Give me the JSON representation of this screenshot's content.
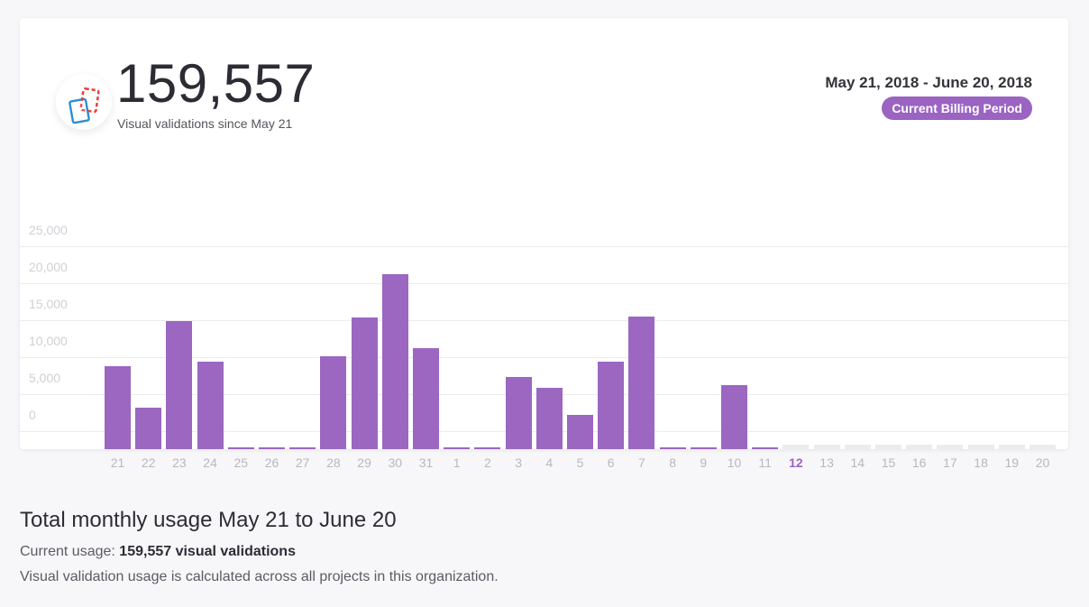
{
  "header": {
    "total_count": "159,557",
    "subtitle": "Visual validations since May 21",
    "period": "May 21, 2018 - June 20, 2018",
    "badge": "Current Billing Period"
  },
  "colors": {
    "accent": "#9b63c2",
    "bar": "#9b67c1",
    "future_bar": "#ececf0",
    "logo_red": "#e8413a",
    "logo_blue": "#2b8fd6"
  },
  "icons": {
    "logo": "overlapping-pages-icon"
  },
  "chart_data": {
    "type": "bar",
    "y_tick_labels": [
      "25,000",
      "20,000",
      "15,000",
      "10,000",
      "5,000",
      "0"
    ],
    "categories": [
      "21",
      "22",
      "23",
      "24",
      "25",
      "26",
      "27",
      "28",
      "29",
      "30",
      "31",
      "1",
      "2",
      "3",
      "4",
      "5",
      "6",
      "7",
      "8",
      "9",
      "10",
      "11",
      "12",
      "13",
      "14",
      "15",
      "16",
      "17",
      "18",
      "19",
      "20"
    ],
    "values": [
      11200,
      5600,
      17300,
      11800,
      300,
      100,
      100,
      12600,
      17800,
      23700,
      13600,
      300,
      100,
      9700,
      8300,
      4600,
      11800,
      17900,
      100,
      100,
      8600,
      100,
      null,
      null,
      null,
      null,
      null,
      null,
      null,
      null,
      null
    ],
    "highlight_category": "12",
    "ylim": [
      -3000,
      27000
    ],
    "grid": true
  },
  "summary": {
    "title": "Total monthly usage May 21 to June 20",
    "current_usage_label": "Current usage:",
    "current_usage_value": "159,557 visual validations",
    "note": "Visual validation usage is calculated across all projects in this organization."
  }
}
